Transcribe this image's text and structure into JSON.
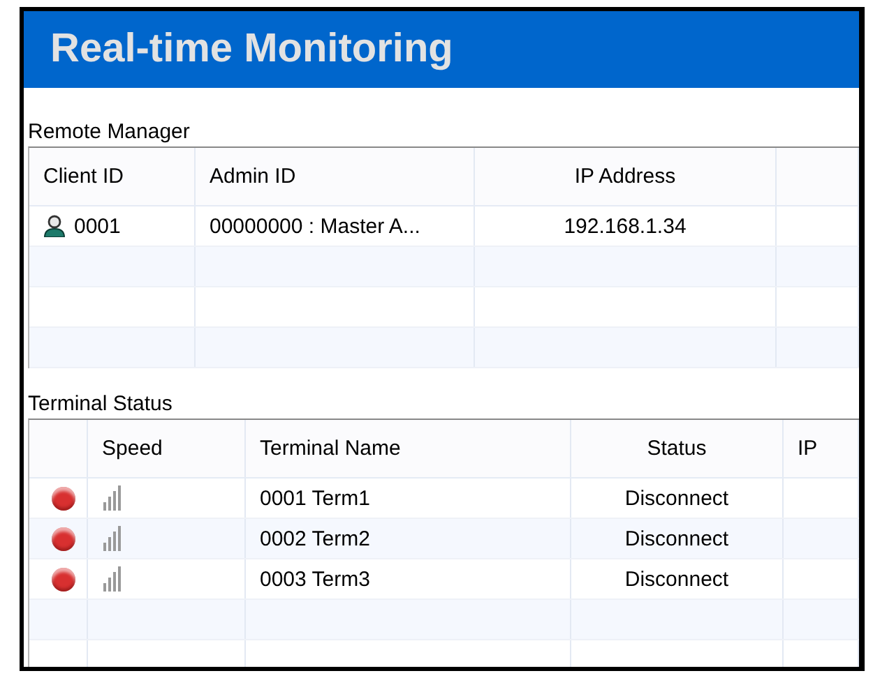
{
  "window": {
    "title": "Real-time Monitoring"
  },
  "remote_manager": {
    "label": "Remote Manager",
    "columns": [
      "Client ID",
      "Admin ID",
      "IP Address"
    ],
    "rows": [
      {
        "client_id": "0001",
        "admin_id": "00000000 : Master A...",
        "ip_address": "192.168.1.34"
      }
    ]
  },
  "terminal_status": {
    "label": "Terminal Status",
    "columns": [
      "Speed",
      "Terminal Name",
      "Status",
      "IP"
    ],
    "rows": [
      {
        "color": "#d83030",
        "terminal_name": "0001 Term1",
        "status": "Disconnect"
      },
      {
        "color": "#d83030",
        "terminal_name": "0002 Term2",
        "status": "Disconnect"
      },
      {
        "color": "#d83030",
        "terminal_name": "0003 Term3",
        "status": "Disconnect"
      }
    ]
  }
}
